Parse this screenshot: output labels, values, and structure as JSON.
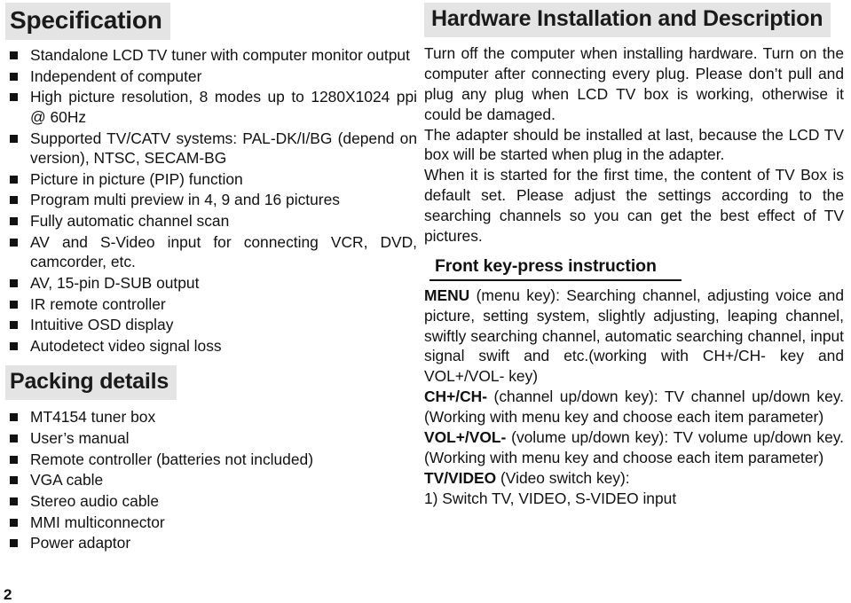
{
  "document": {
    "page_number": "2",
    "band_color": "#e4e4e4",
    "text_color": "#111111"
  },
  "left_column": {
    "specification": {
      "heading": "Specification",
      "items": [
        "Standalone LCD TV tuner with computer monitor output",
        "Independent of computer",
        "High picture resolution, 8 modes up to 1280X1024 ppi @ 60Hz",
        "Supported TV/CATV systems: PAL-DK/I/BG (depend on version), NTSC, SECAM-BG",
        "Picture in picture (PIP) function",
        "Program multi preview in 4, 9 and 16 pictures",
        "Fully automatic channel scan",
        "AV and S-Video input for connecting VCR, DVD, camcorder, etc.",
        "AV, 15-pin D-SUB output",
        "IR remote controller",
        "Intuitive OSD display",
        "Autodetect video signal loss"
      ]
    },
    "packing": {
      "heading": "Packing details",
      "items": [
        "MT4154 tuner box",
        "User’s manual",
        "Remote controller (batteries not included)",
        "VGA cable",
        "Stereo audio cable",
        "MMI multiconnector",
        "Power adaptor"
      ]
    }
  },
  "right_column": {
    "heading": "Hardware Installation and Description",
    "paragraphs": [
      "Turn off the computer when installing hardware. Turn on the computer after connecting every plug. Please don’t pull and plug any plug when LCD TV box is working, otherwise it could be damaged.",
      "The adapter should be installed at last, because the LCD TV box will be started when plug in the adapter.",
      "When it is started for the first time, the content of TV Box is default set. Please adjust the settings according to the searching channels so you can get the best effect of TV pictures."
    ],
    "subheading": "Front key-press instruction",
    "keys": [
      {
        "name": "MENU",
        "description": " (menu key): Searching channel, adjusting voice and picture, setting system, slightly adjusting, leaping channel, swiftly searching channel, automatic searching channel, input signal swift and etc.(working with CH+/CH- key and VOL+/VOL- key)"
      },
      {
        "name": "CH+/CH-",
        "description": " (channel up/down key): TV channel up/down key. (Working with menu key and choose each item parameter)"
      },
      {
        "name": "VOL+/VOL-",
        "description": " (volume up/down key): TV volume up/down key. (Working with menu key and choose each item parameter)"
      },
      {
        "name": "TV/VIDEO",
        "description": " (Video switch key):"
      }
    ],
    "numbered_item": "1)  Switch TV, VIDEO, S-VIDEO input"
  }
}
